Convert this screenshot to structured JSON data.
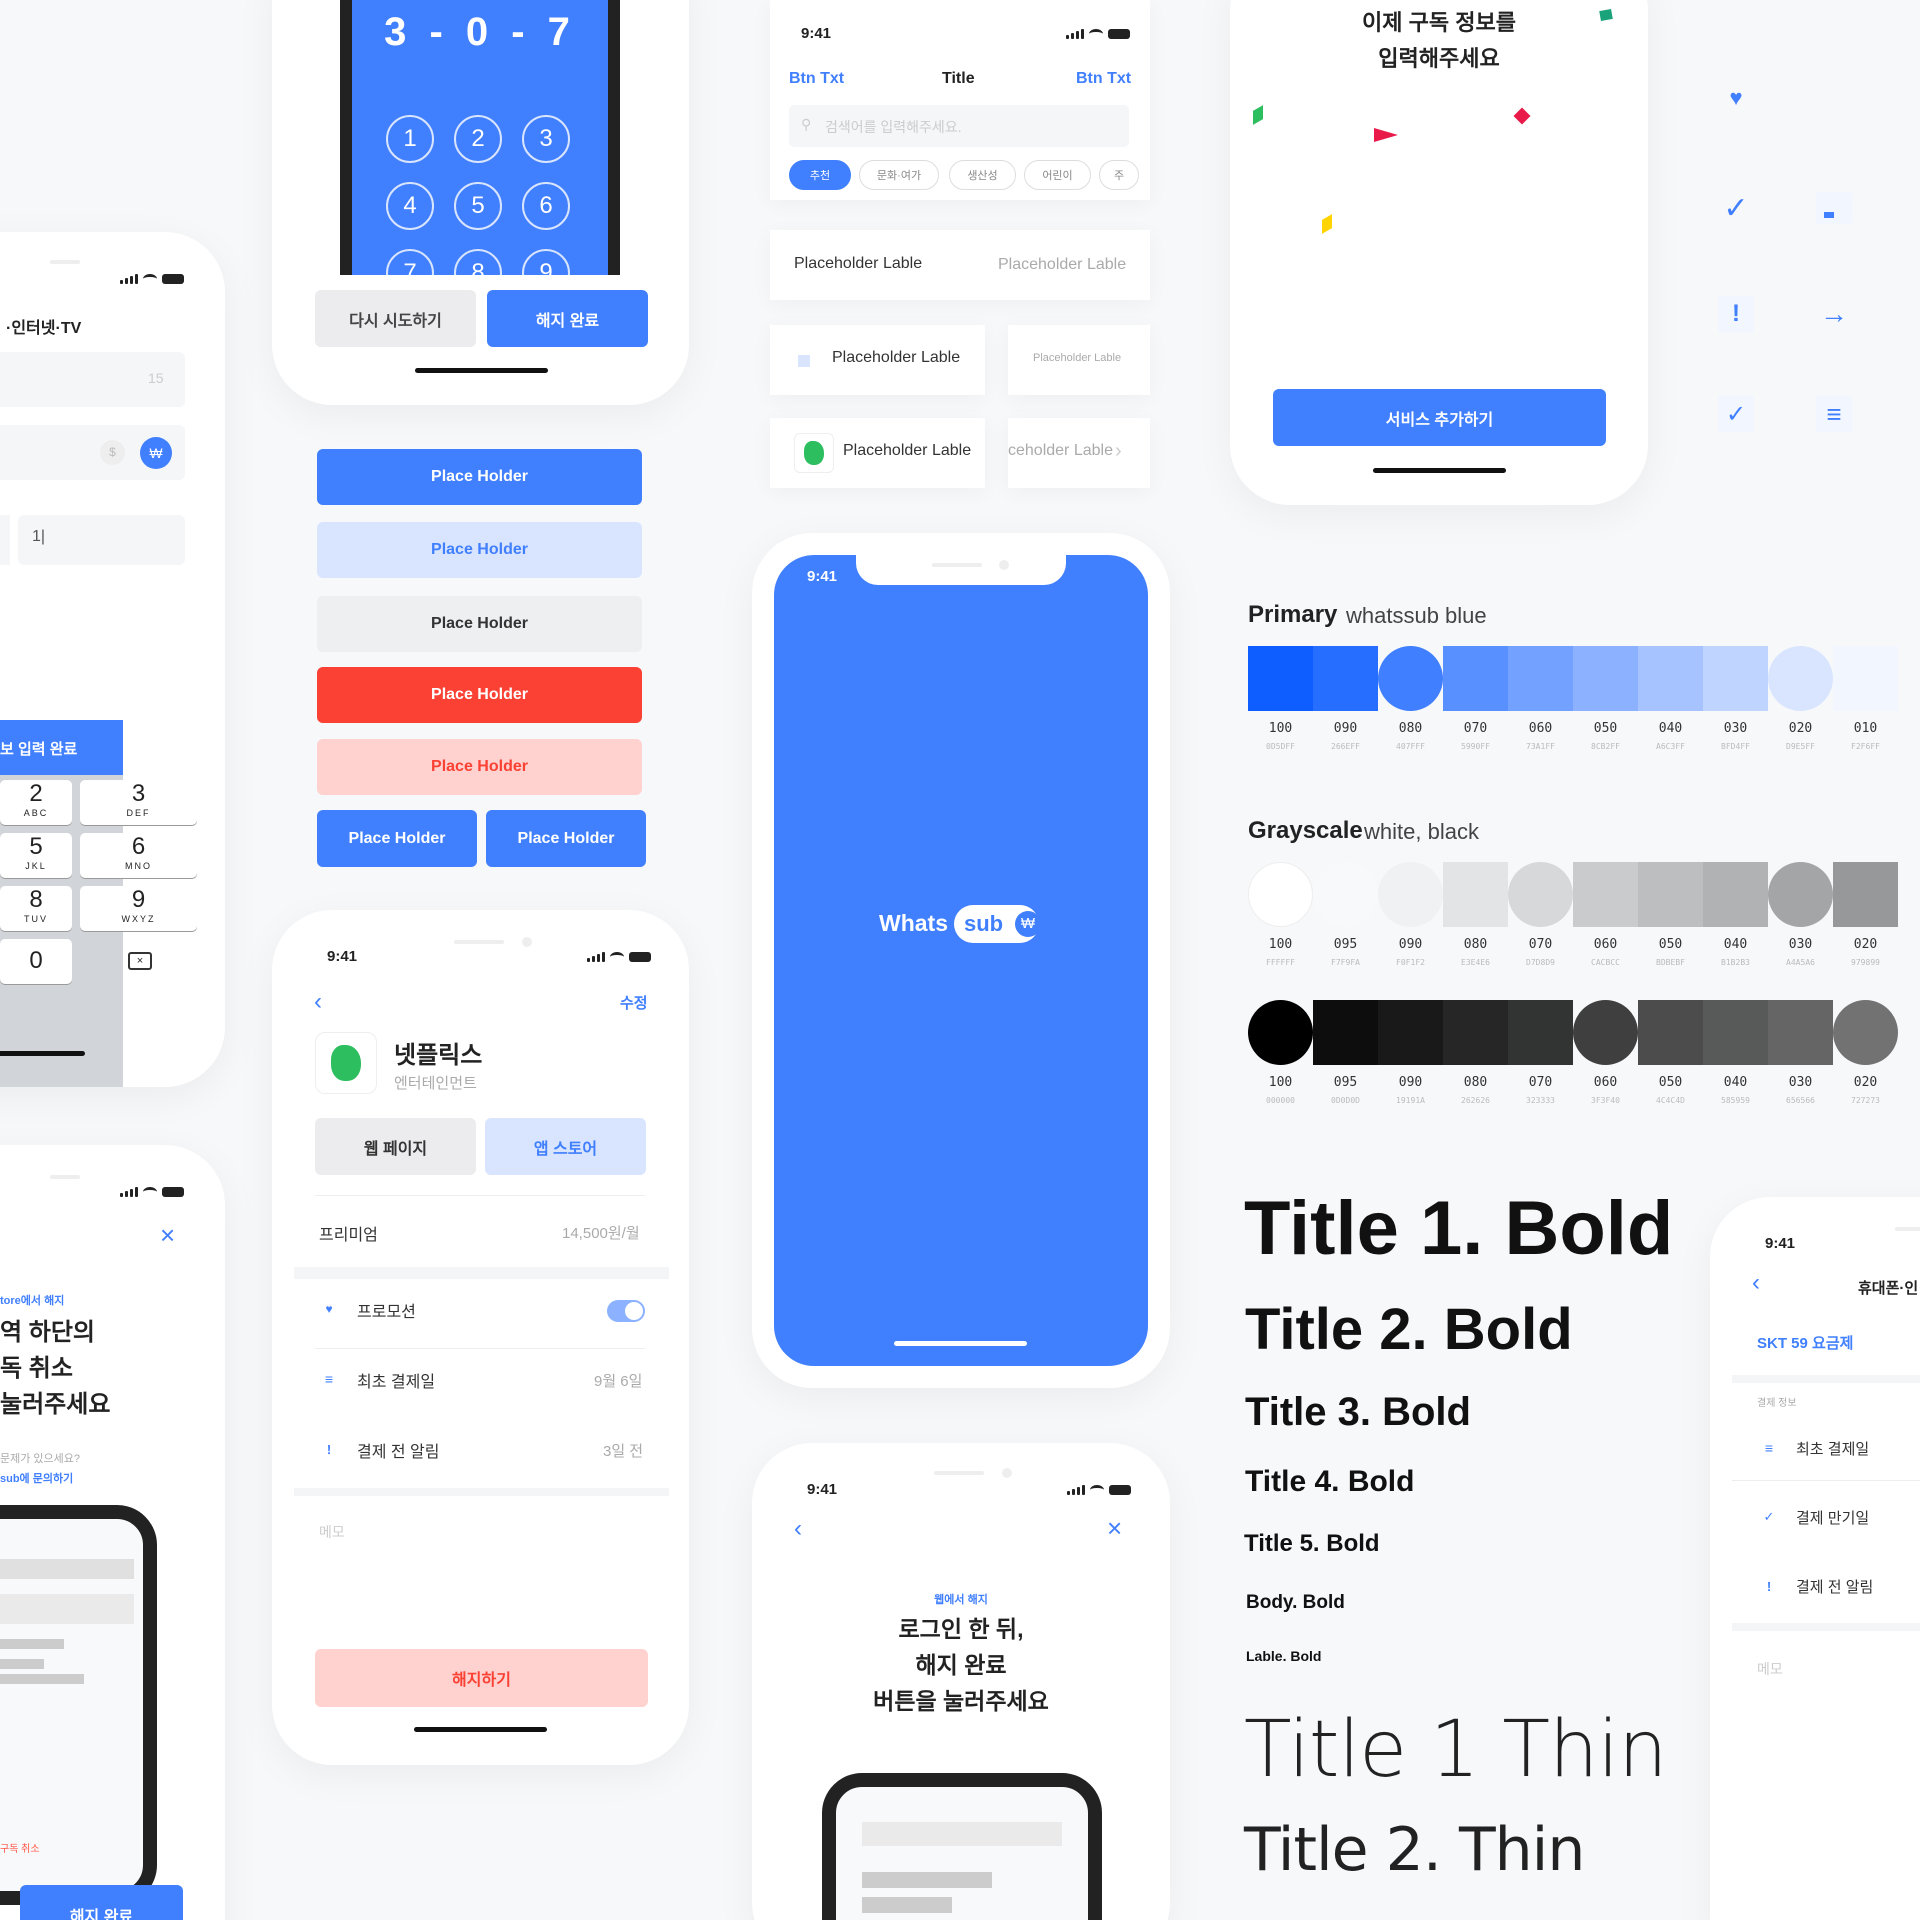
{
  "pin": {
    "digits": "3 - 0 - 7",
    "keys": [
      "1",
      "2",
      "3",
      "4",
      "5",
      "6",
      "7",
      "8",
      "9"
    ],
    "retry": "다시 시도하기",
    "done": "해지 완료"
  },
  "left1": {
    "title": "·인터넷·TV",
    "counter": "15",
    "sym_dollar": "$",
    "sym_won": "₩",
    "typed": "1|",
    "banner": "보 입력 완료",
    "keys": [
      {
        "n": "2",
        "l": "ABC"
      },
      {
        "n": "3",
        "l": "DEF"
      },
      {
        "n": "5",
        "l": "JKL"
      },
      {
        "n": "6",
        "l": "MNO"
      },
      {
        "n": "8",
        "l": "TUV"
      },
      {
        "n": "9",
        "l": "WXYZ"
      },
      {
        "n": "0",
        "l": ""
      }
    ]
  },
  "left2": {
    "eyebrow": "tore에서 해지",
    "line1": "역 하단의",
    "line2": "독 취소",
    "line3": "눌러주세요",
    "q": "문제가 있으세요?",
    "link": "sub에 문의하기",
    "cancel": "구독 취소",
    "done": "해지 완료"
  },
  "buttons": [
    "Place Holder",
    "Place Holder",
    "Place Holder",
    "Place Holder",
    "Place Holder",
    "Place Holder",
    "Place Holder"
  ],
  "detail": {
    "time": "9:41",
    "edit": "수정",
    "name": "넷플릭스",
    "category": "엔터테인먼트",
    "web": "웹 페이지",
    "store": "앱 스토어",
    "plan": "프리미엄",
    "price": "14,500원/월",
    "promo": "프로모션",
    "first_pay": "최초 결제일",
    "first_pay_val": "9월 6일",
    "notify": "결제 전 알림",
    "notify_val": "3일 전",
    "memo": "메모",
    "cancel": "해지하기"
  },
  "search": {
    "time": "9:41",
    "left": "Btn Txt",
    "title": "Title",
    "right": "Btn Txt",
    "placeholder": "검색어를 입력해주세요.",
    "chips": [
      "추천",
      "문화·여가",
      "생산성",
      "어린이",
      "주"
    ]
  },
  "tiles": {
    "a1": "Placeholder Lable",
    "a2": "Placeholder Lable",
    "b1": "Placeholder Lable",
    "b2": "Placeholder Lable",
    "c1": "Placeholder Lable",
    "c2": "ceholder Lable"
  },
  "splash": {
    "time": "9:41",
    "logo1": "Whats",
    "logo2": "sub"
  },
  "login": {
    "time": "9:41",
    "eyebrow": "웹에서 해지",
    "line1": "로그인 한 뒤,",
    "line2": "해지 완료",
    "line3": "버튼을 눌러주세요"
  },
  "sub": {
    "line1": "이제 구독 정보를",
    "line2": "입력해주세요",
    "cta": "서비스 추가하기"
  },
  "primary": {
    "title": "Primary",
    "subtitle": "whatssub blue",
    "swatches": [
      {
        "n": "100",
        "h": "0D5DFF",
        "c": "#0d5dff"
      },
      {
        "n": "090",
        "h": "266EFF",
        "c": "#266eff"
      },
      {
        "n": "080",
        "h": "407FFF",
        "c": "#407fff"
      },
      {
        "n": "070",
        "h": "5990FF",
        "c": "#5990ff"
      },
      {
        "n": "060",
        "h": "73A1FF",
        "c": "#73a1ff"
      },
      {
        "n": "050",
        "h": "8CB2FF",
        "c": "#8cb2ff"
      },
      {
        "n": "040",
        "h": "A6C3FF",
        "c": "#a6c3ff"
      },
      {
        "n": "030",
        "h": "BFD4FF",
        "c": "#bfd4ff"
      },
      {
        "n": "020",
        "h": "D9E5FF",
        "c": "#d9e5ff"
      },
      {
        "n": "010",
        "h": "F2F6FF",
        "c": "#f2f6ff"
      }
    ]
  },
  "gray": {
    "title": "Grayscale",
    "subtitle": "white, black",
    "white": [
      {
        "n": "100",
        "h": "FFFFFF",
        "c": "#ffffff"
      },
      {
        "n": "095",
        "h": "F7F9FA",
        "c": "#f7f9fa"
      },
      {
        "n": "090",
        "h": "F0F1F2",
        "c": "#f0f1f2"
      },
      {
        "n": "080",
        "h": "E3E4E6",
        "c": "#e3e4e6"
      },
      {
        "n": "070",
        "h": "D7D8D9",
        "c": "#d7d8d9"
      },
      {
        "n": "060",
        "h": "CACBCC",
        "c": "#cacbcc"
      },
      {
        "n": "050",
        "h": "BDBEBF",
        "c": "#bdbebf"
      },
      {
        "n": "040",
        "h": "B1B2B3",
        "c": "#b1b2b3"
      },
      {
        "n": "030",
        "h": "A4A5A6",
        "c": "#a4a5a6"
      },
      {
        "n": "020",
        "h": "979899",
        "c": "#979899"
      }
    ],
    "black": [
      {
        "n": "100",
        "h": "000000",
        "c": "#000000"
      },
      {
        "n": "095",
        "h": "0D0D0D",
        "c": "#0d0d0d"
      },
      {
        "n": "090",
        "h": "19191A",
        "c": "#19191a"
      },
      {
        "n": "080",
        "h": "262626",
        "c": "#262626"
      },
      {
        "n": "070",
        "h": "323333",
        "c": "#323333"
      },
      {
        "n": "060",
        "h": "3F3F40",
        "c": "#3f3f40"
      },
      {
        "n": "050",
        "h": "4C4C4D",
        "c": "#4c4c4d"
      },
      {
        "n": "040",
        "h": "585959",
        "c": "#585959"
      },
      {
        "n": "030",
        "h": "656566",
        "c": "#656566"
      },
      {
        "n": "020",
        "h": "727273",
        "c": "#727273"
      }
    ]
  },
  "type": {
    "t1": "Title 1. Bold",
    "t2": "Title 2. Bold",
    "t3": "Title 3. Bold",
    "t4": "Title 4. Bold",
    "t5": "Title 5. Bold",
    "body": "Body. Bold",
    "label": "Lable. Bold",
    "thin1": "Title 1 Thin",
    "thin2": "Title 2. Thin"
  },
  "right": {
    "time": "9:41",
    "title": "휴대폰·인",
    "plan": "SKT 59 요금제",
    "section": "결제 정보",
    "r1": "최초 결제일",
    "r2": "결제 만기일",
    "r3": "결제 전 알림",
    "memo": "메모"
  }
}
